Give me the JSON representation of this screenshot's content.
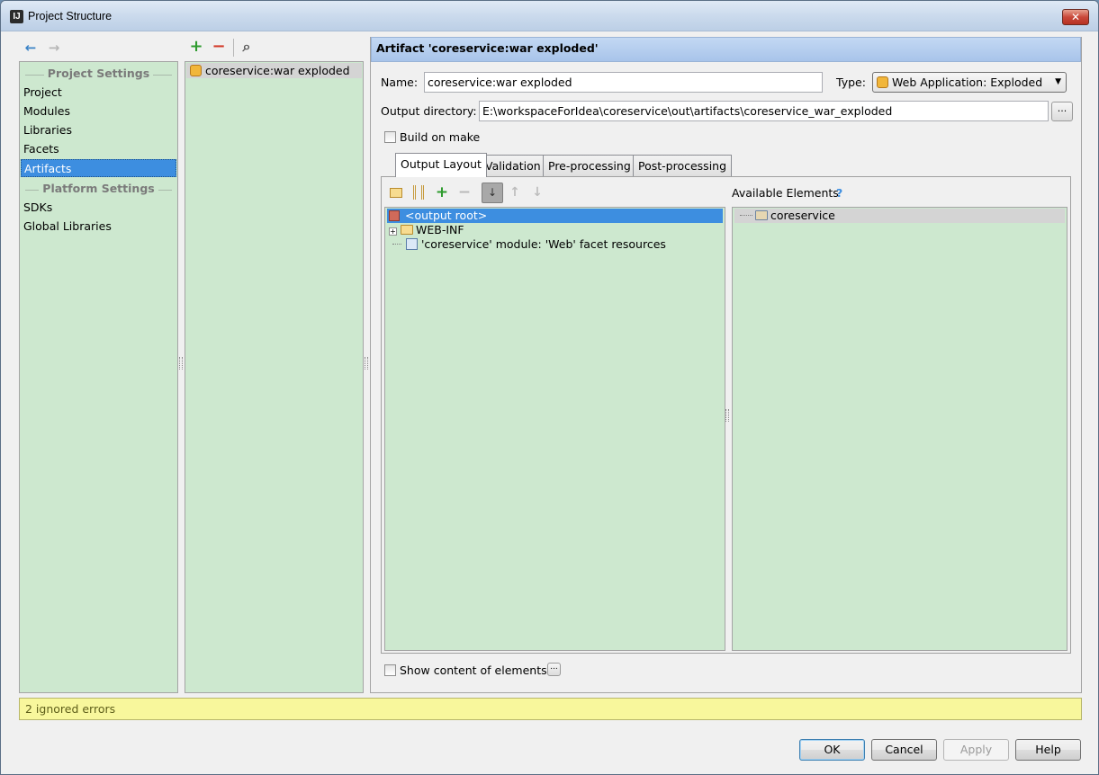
{
  "window": {
    "title": "Project Structure",
    "close_glyph": "✕",
    "app_icon_text": "IJ"
  },
  "toolbar": {
    "back_icon": "←",
    "forward_icon": "→",
    "add_icon": "+",
    "remove_icon": "−",
    "find_icon": "⌕"
  },
  "sidebar": {
    "project_settings_header": "Project Settings",
    "platform_settings_header": "Platform Settings",
    "items": [
      "Project",
      "Modules",
      "Libraries",
      "Facets",
      "Artifacts"
    ],
    "platform_items": [
      "SDKs",
      "Global Libraries"
    ],
    "selected": "Artifacts"
  },
  "artifacts_list": {
    "items": [
      "coreservice:war exploded"
    ]
  },
  "artifact": {
    "header": "Artifact 'coreservice:war exploded'",
    "name_label": "Name:",
    "name_value": "coreservice:war exploded",
    "type_label": "Type:",
    "type_value": "Web Application: Exploded",
    "output_label": "Output directory:",
    "output_value": "E:\\workspaceForIdea\\coreservice\\out\\artifacts\\coreservice_war_exploded",
    "build_on_make": "Build on make",
    "browse_label": "..."
  },
  "tabs": [
    "Output Layout",
    "Validation",
    "Pre-processing",
    "Post-processing"
  ],
  "layout": {
    "tree": [
      "<output root>",
      "WEB-INF",
      "'coreservice' module: 'Web' facet resources"
    ],
    "available_title": "Available Elements",
    "help_glyph": "?",
    "available": [
      "coreservice"
    ],
    "show_content": "Show content of elements",
    "show_content_btn": "..."
  },
  "status": {
    "text": "2 ignored errors"
  },
  "buttons": {
    "ok": "OK",
    "cancel": "Cancel",
    "apply": "Apply",
    "help": "Help"
  },
  "colors": {
    "accent": "#3d8ee0",
    "panel": "#cde8cf",
    "status": "#f8f79c"
  }
}
